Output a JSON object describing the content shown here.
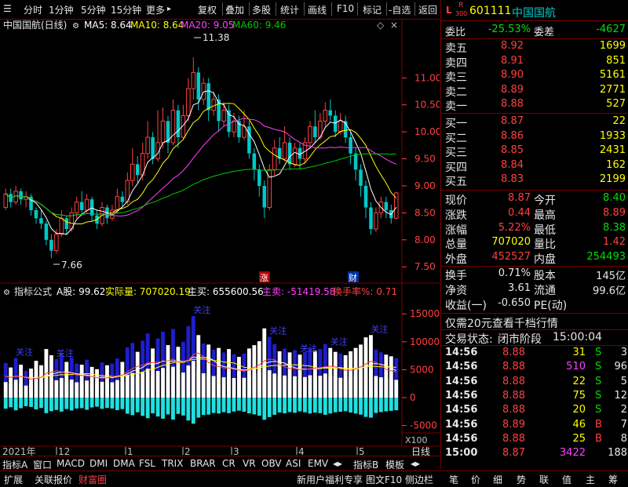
{
  "toolbar": {
    "items": [
      "分时",
      "1分钟",
      "5分钟",
      "15分钟",
      "更多"
    ],
    "more_arrow": "▸",
    "right_items": [
      "复权",
      "叠加",
      "多股",
      "统计",
      "画线",
      "F10",
      "标记",
      "-自选",
      "返回"
    ]
  },
  "main_chart": {
    "title": "中国国航(日线)",
    "ma": [
      {
        "label": "MA5: 8.64",
        "color": "#ffffff"
      },
      {
        "label": "MA10: 8.64",
        "color": "#ffff00"
      },
      {
        "label": "MA20: 9.05",
        "color": "#ff40ff"
      },
      {
        "label": "MA60: 9.46",
        "color": "#00c800"
      }
    ],
    "y_ticks": [
      "11.00",
      "10.50",
      "10.00",
      "9.50",
      "9.00",
      "8.50",
      "8.00",
      "7.50"
    ],
    "high_label": "11.38",
    "low_label": "7.66",
    "marker_zhang": "涨",
    "marker_cai": "财"
  },
  "indicator": {
    "name": "指标公式",
    "items": [
      {
        "text": "A股: 99.62",
        "color": "#ffffff"
      },
      {
        "text": "实际量: 707020.19",
        "color": "#ffff00"
      },
      {
        "text": "主买: 655600.56",
        "color": "#ffffff"
      },
      {
        "text": "主卖: -51419.58",
        "color": "#ff40ff"
      },
      {
        "text": "换手率%: 0.71",
        "color": "#ff4040"
      }
    ],
    "y_ticks": [
      "15000",
      "10000",
      "5000",
      "0",
      "-5000"
    ],
    "unit": "X100",
    "tags": [
      "关注",
      "关注",
      "关注",
      "关注",
      "关注",
      "关注",
      "关注"
    ]
  },
  "x_axis": {
    "labels": [
      "2021年",
      "12",
      "1",
      "2",
      "3",
      "4",
      "5"
    ],
    "period": "日线"
  },
  "bottom_tabs": {
    "row1": [
      "指标A",
      "窗口",
      "MACD",
      "DMI",
      "DMA",
      "FSL",
      "TRIX",
      "BRAR",
      "CR",
      "VR",
      "OBV",
      "ASI",
      "EMV"
    ],
    "row1_more": "◂▸",
    "row1_right": [
      "指标B",
      "模板"
    ],
    "row2": [
      "扩展",
      "关联报价",
      "财富圈"
    ],
    "row2_promo": "新用户福利专享",
    "row2_right": [
      "图文F10",
      "侧边栏"
    ],
    "right_tabs": [
      "笔",
      "价",
      "细",
      "势",
      "联",
      "值",
      "主",
      "筹"
    ]
  },
  "quote": {
    "code": "601111",
    "name": "中国国航",
    "tag_l": "L",
    "tag_r": "R",
    "tag_num": "300",
    "weibi_label": "委比",
    "weibi": "-25.53%",
    "weicha_label": "委差",
    "weicha": "-4627",
    "sell": [
      {
        "label": "卖五",
        "price": "8.92",
        "vol": "1699"
      },
      {
        "label": "卖四",
        "price": "8.91",
        "vol": "851"
      },
      {
        "label": "卖三",
        "price": "8.90",
        "vol": "5161"
      },
      {
        "label": "卖二",
        "price": "8.89",
        "vol": "2771"
      },
      {
        "label": "卖一",
        "price": "8.88",
        "vol": "527"
      }
    ],
    "buy": [
      {
        "label": "买一",
        "price": "8.87",
        "vol": "22"
      },
      {
        "label": "买二",
        "price": "8.86",
        "vol": "1933"
      },
      {
        "label": "买三",
        "price": "8.85",
        "vol": "2431"
      },
      {
        "label": "买四",
        "price": "8.84",
        "vol": "162"
      },
      {
        "label": "买五",
        "price": "8.83",
        "vol": "2199"
      }
    ],
    "stats": [
      {
        "l1": "现价",
        "v1": "8.87",
        "c1": "#ff4040",
        "l2": "今开",
        "v2": "8.40",
        "c2": "#00e000"
      },
      {
        "l1": "涨跌",
        "v1": "0.44",
        "c1": "#ff4040",
        "l2": "最高",
        "v2": "8.89",
        "c2": "#ff4040"
      },
      {
        "l1": "涨幅",
        "v1": "5.22%",
        "c1": "#ff4040",
        "l2": "最低",
        "v2": "8.38",
        "c2": "#00e000"
      },
      {
        "l1": "总量",
        "v1": "707020",
        "c1": "#ffff00",
        "l2": "量比",
        "v2": "1.42",
        "c2": "#ff4040"
      },
      {
        "l1": "外盘",
        "v1": "452527",
        "c1": "#ff4040",
        "l2": "内盘",
        "v2": "254493",
        "c2": "#00e000"
      }
    ],
    "stats2": [
      {
        "l1": "换手",
        "v1": "0.71%",
        "l2": "股本",
        "v2": "145亿"
      },
      {
        "l1": "净资",
        "v1": "3.61",
        "l2": "流通",
        "v2": "99.6亿"
      },
      {
        "l1": "收益(一)",
        "v1": "-0.650",
        "l2": "PE(动)",
        "v2": ""
      }
    ],
    "promo": "仅需20元查看千档行情",
    "status_label": "交易状态:",
    "status": "闭市阶段",
    "status_time": "15:00:04",
    "ticks": [
      {
        "t": "14:56",
        "p": "8.88",
        "v": "31",
        "vc": "#ffff00",
        "s": "S",
        "sc": "#00e000",
        "n": "3"
      },
      {
        "t": "14:56",
        "p": "8.88",
        "v": "510",
        "vc": "#ff40ff",
        "s": "S",
        "sc": "#00e000",
        "n": "96"
      },
      {
        "t": "14:56",
        "p": "8.88",
        "v": "22",
        "vc": "#ffff00",
        "s": "S",
        "sc": "#00e000",
        "n": "5"
      },
      {
        "t": "14:56",
        "p": "8.88",
        "v": "75",
        "vc": "#ffff00",
        "s": "S",
        "sc": "#00e000",
        "n": "12"
      },
      {
        "t": "14:56",
        "p": "8.88",
        "v": "20",
        "vc": "#ffff00",
        "s": "S",
        "sc": "#00e000",
        "n": "2"
      },
      {
        "t": "14:56",
        "p": "8.89",
        "v": "46",
        "vc": "#ffff00",
        "s": "B",
        "sc": "#ff4040",
        "n": "7"
      },
      {
        "t": "14:56",
        "p": "8.88",
        "v": "25",
        "vc": "#ffff00",
        "s": "B",
        "sc": "#ff4040",
        "n": "8"
      },
      {
        "t": "15:00",
        "p": "8.87",
        "v": "3422",
        "vc": "#ff40ff",
        "s": "",
        "sc": "#ffffff",
        "n": "188"
      }
    ]
  },
  "chart_data": {
    "type": "candlestick",
    "title": "中国国航(日线)",
    "ylim": [
      7.3,
      11.6
    ],
    "candles": [
      [
        8.6,
        8.85,
        8.55,
        8.95
      ],
      [
        8.85,
        8.7,
        8.6,
        8.95
      ],
      [
        8.7,
        8.9,
        8.65,
        9.0
      ],
      [
        8.9,
        8.75,
        8.65,
        8.95
      ],
      [
        8.75,
        8.8,
        8.6,
        8.9
      ],
      [
        8.8,
        8.55,
        8.45,
        8.85
      ],
      [
        8.55,
        8.4,
        8.3,
        8.6
      ],
      [
        8.4,
        8.3,
        8.2,
        8.55
      ],
      [
        8.3,
        8.0,
        7.9,
        8.35
      ],
      [
        8.0,
        7.8,
        7.66,
        8.1
      ],
      [
        7.8,
        8.1,
        7.75,
        8.2
      ],
      [
        8.1,
        8.4,
        8.05,
        8.55
      ],
      [
        8.4,
        8.2,
        8.1,
        8.45
      ],
      [
        8.2,
        8.5,
        8.15,
        8.6
      ],
      [
        8.5,
        8.7,
        8.4,
        8.8
      ],
      [
        8.7,
        8.55,
        8.45,
        8.9
      ],
      [
        8.55,
        8.75,
        8.5,
        8.85
      ],
      [
        8.75,
        8.45,
        8.35,
        8.8
      ],
      [
        8.45,
        8.3,
        8.2,
        8.55
      ],
      [
        8.3,
        8.6,
        8.25,
        8.7
      ],
      [
        8.6,
        8.4,
        8.3,
        8.65
      ],
      [
        8.4,
        8.55,
        8.35,
        8.65
      ],
      [
        8.55,
        8.8,
        8.5,
        8.95
      ],
      [
        8.8,
        8.7,
        8.6,
        8.9
      ],
      [
        8.7,
        9.1,
        8.65,
        9.25
      ],
      [
        9.1,
        9.4,
        9.0,
        9.7
      ],
      [
        9.4,
        9.2,
        9.05,
        9.55
      ],
      [
        9.2,
        9.6,
        9.1,
        9.8
      ],
      [
        9.6,
        9.9,
        9.5,
        10.2
      ],
      [
        9.9,
        9.5,
        9.4,
        10.0
      ],
      [
        9.5,
        9.8,
        9.45,
        10.4
      ],
      [
        9.8,
        10.2,
        9.7,
        10.45
      ],
      [
        10.2,
        9.8,
        9.6,
        10.3
      ],
      [
        9.8,
        10.4,
        9.75,
        10.6
      ],
      [
        10.4,
        9.9,
        9.7,
        10.5
      ],
      [
        9.9,
        10.3,
        9.85,
        10.5
      ],
      [
        10.3,
        10.8,
        10.2,
        11.0
      ],
      [
        10.8,
        11.1,
        10.6,
        11.38
      ],
      [
        11.1,
        10.6,
        10.4,
        11.2
      ],
      [
        10.6,
        10.9,
        10.5,
        11.0
      ],
      [
        10.9,
        10.4,
        10.2,
        11.0
      ],
      [
        10.4,
        10.6,
        10.3,
        10.75
      ],
      [
        10.6,
        10.2,
        10.0,
        10.7
      ],
      [
        10.2,
        10.4,
        10.1,
        10.55
      ],
      [
        10.4,
        10.0,
        9.9,
        10.5
      ],
      [
        10.0,
        10.2,
        9.9,
        10.35
      ],
      [
        10.2,
        9.9,
        9.8,
        10.3
      ],
      [
        9.9,
        10.1,
        9.85,
        10.4
      ],
      [
        10.1,
        9.6,
        9.5,
        10.2
      ],
      [
        9.6,
        9.3,
        9.1,
        9.7
      ],
      [
        9.3,
        9.0,
        8.8,
        9.4
      ],
      [
        9.0,
        8.6,
        8.4,
        9.1
      ],
      [
        8.6,
        9.3,
        8.55,
        9.4
      ],
      [
        9.3,
        9.7,
        9.2,
        9.85
      ],
      [
        9.7,
        9.5,
        9.4,
        9.9
      ],
      [
        9.5,
        9.8,
        9.45,
        10.1
      ],
      [
        9.8,
        9.4,
        9.3,
        9.9
      ],
      [
        9.4,
        9.7,
        9.35,
        9.8
      ],
      [
        9.7,
        9.5,
        9.3,
        9.8
      ],
      [
        9.5,
        9.8,
        9.4,
        9.9
      ],
      [
        9.8,
        10.1,
        9.7,
        10.2
      ],
      [
        10.1,
        9.9,
        9.8,
        10.4
      ],
      [
        9.9,
        10.2,
        9.85,
        10.35
      ],
      [
        10.2,
        10.4,
        10.1,
        10.55
      ],
      [
        10.4,
        10.3,
        10.2,
        10.6
      ],
      [
        10.3,
        10.0,
        9.9,
        10.4
      ],
      [
        10.0,
        10.2,
        9.95,
        10.35
      ],
      [
        10.2,
        9.9,
        9.8,
        10.3
      ],
      [
        9.9,
        9.6,
        9.4,
        10.0
      ],
      [
        9.6,
        9.3,
        9.1,
        9.7
      ],
      [
        9.3,
        9.0,
        8.8,
        9.4
      ],
      [
        9.0,
        8.6,
        8.4,
        9.1
      ],
      [
        8.6,
        8.2,
        8.1,
        8.7
      ],
      [
        8.2,
        8.5,
        8.15,
        8.6
      ],
      [
        8.5,
        8.7,
        8.4,
        8.8
      ],
      [
        8.7,
        8.55,
        8.4,
        8.8
      ],
      [
        8.55,
        8.4,
        8.3,
        8.65
      ],
      [
        8.4,
        8.87,
        8.38,
        8.89
      ]
    ],
    "volume": [
      6200,
      5400,
      7100,
      5900,
      4800,
      5200,
      6600,
      5800,
      8700,
      7600,
      6900,
      7800,
      6400,
      7200,
      6100,
      5900,
      6800,
      5500,
      5100,
      6300,
      5800,
      6100,
      7000,
      6400,
      9000,
      9800,
      8200,
      10200,
      11500,
      8800,
      10600,
      11800,
      9400,
      12300,
      9100,
      10000,
      12800,
      14600,
      11200,
      9700,
      9500,
      8600,
      8900,
      8100,
      8700,
      7800,
      7300,
      7900,
      8800,
      9400,
      10100,
      12400,
      10900,
      9600,
      8300,
      8800,
      8100,
      8500,
      7700,
      8200,
      8900,
      8400,
      8700,
      9600,
      8900,
      8200,
      7900,
      7600,
      8300,
      8900,
      9500,
      10800,
      11200,
      8600,
      8100,
      7700,
      7400,
      7070
    ],
    "series_ma": [
      "MA5",
      "MA10",
      "MA20",
      "MA60"
    ],
    "indicator_ylim": [
      -8000,
      17000
    ]
  }
}
